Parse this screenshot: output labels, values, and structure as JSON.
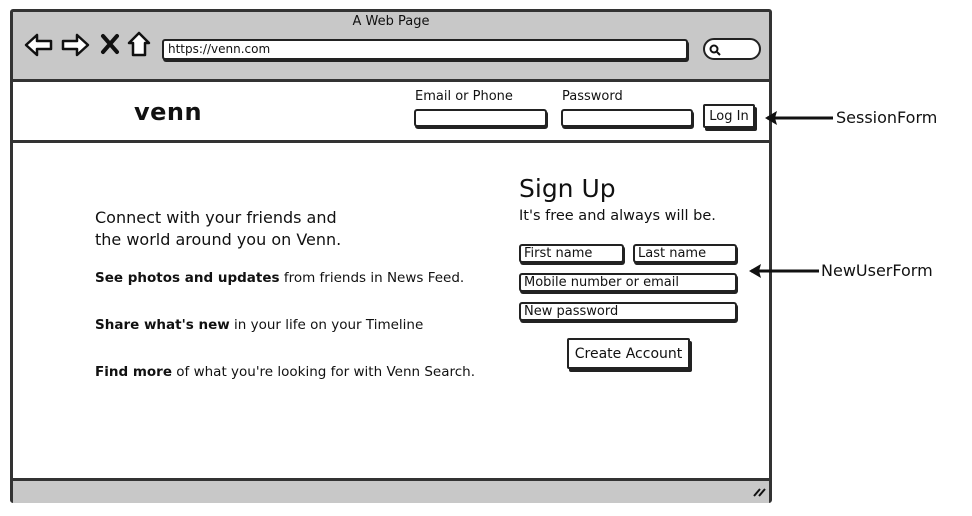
{
  "browser": {
    "title": "A Web Page",
    "url": "https://venn.com"
  },
  "header": {
    "logo": "venn",
    "email_label": "Email or Phone",
    "password_label": "Password",
    "login_label": "Log In"
  },
  "intro": {
    "tagline_line1": "Connect with your friends and",
    "tagline_line2": "the world around you on Venn.",
    "features": [
      {
        "bold": "See photos and updates",
        "rest": "from friends in News Feed."
      },
      {
        "bold": "Share what's new",
        "rest": "in your life on your Timeline"
      },
      {
        "bold": "Find more",
        "rest": "of what you're looking for with Venn Search."
      }
    ]
  },
  "signup": {
    "title": "Sign Up",
    "subtitle": "It's free and always will be.",
    "first_name_placeholder": "First name",
    "last_name_placeholder": "Last name",
    "contact_placeholder": "Mobile number or email",
    "password_placeholder": "New password",
    "submit_label": "Create Account"
  },
  "annotations": {
    "session_form": "SessionForm",
    "new_user_form": "NewUserForm"
  },
  "icons": [
    "back-arrow-icon",
    "forward-arrow-icon",
    "close-icon",
    "home-icon",
    "search-icon",
    "resize-grip-icon"
  ]
}
